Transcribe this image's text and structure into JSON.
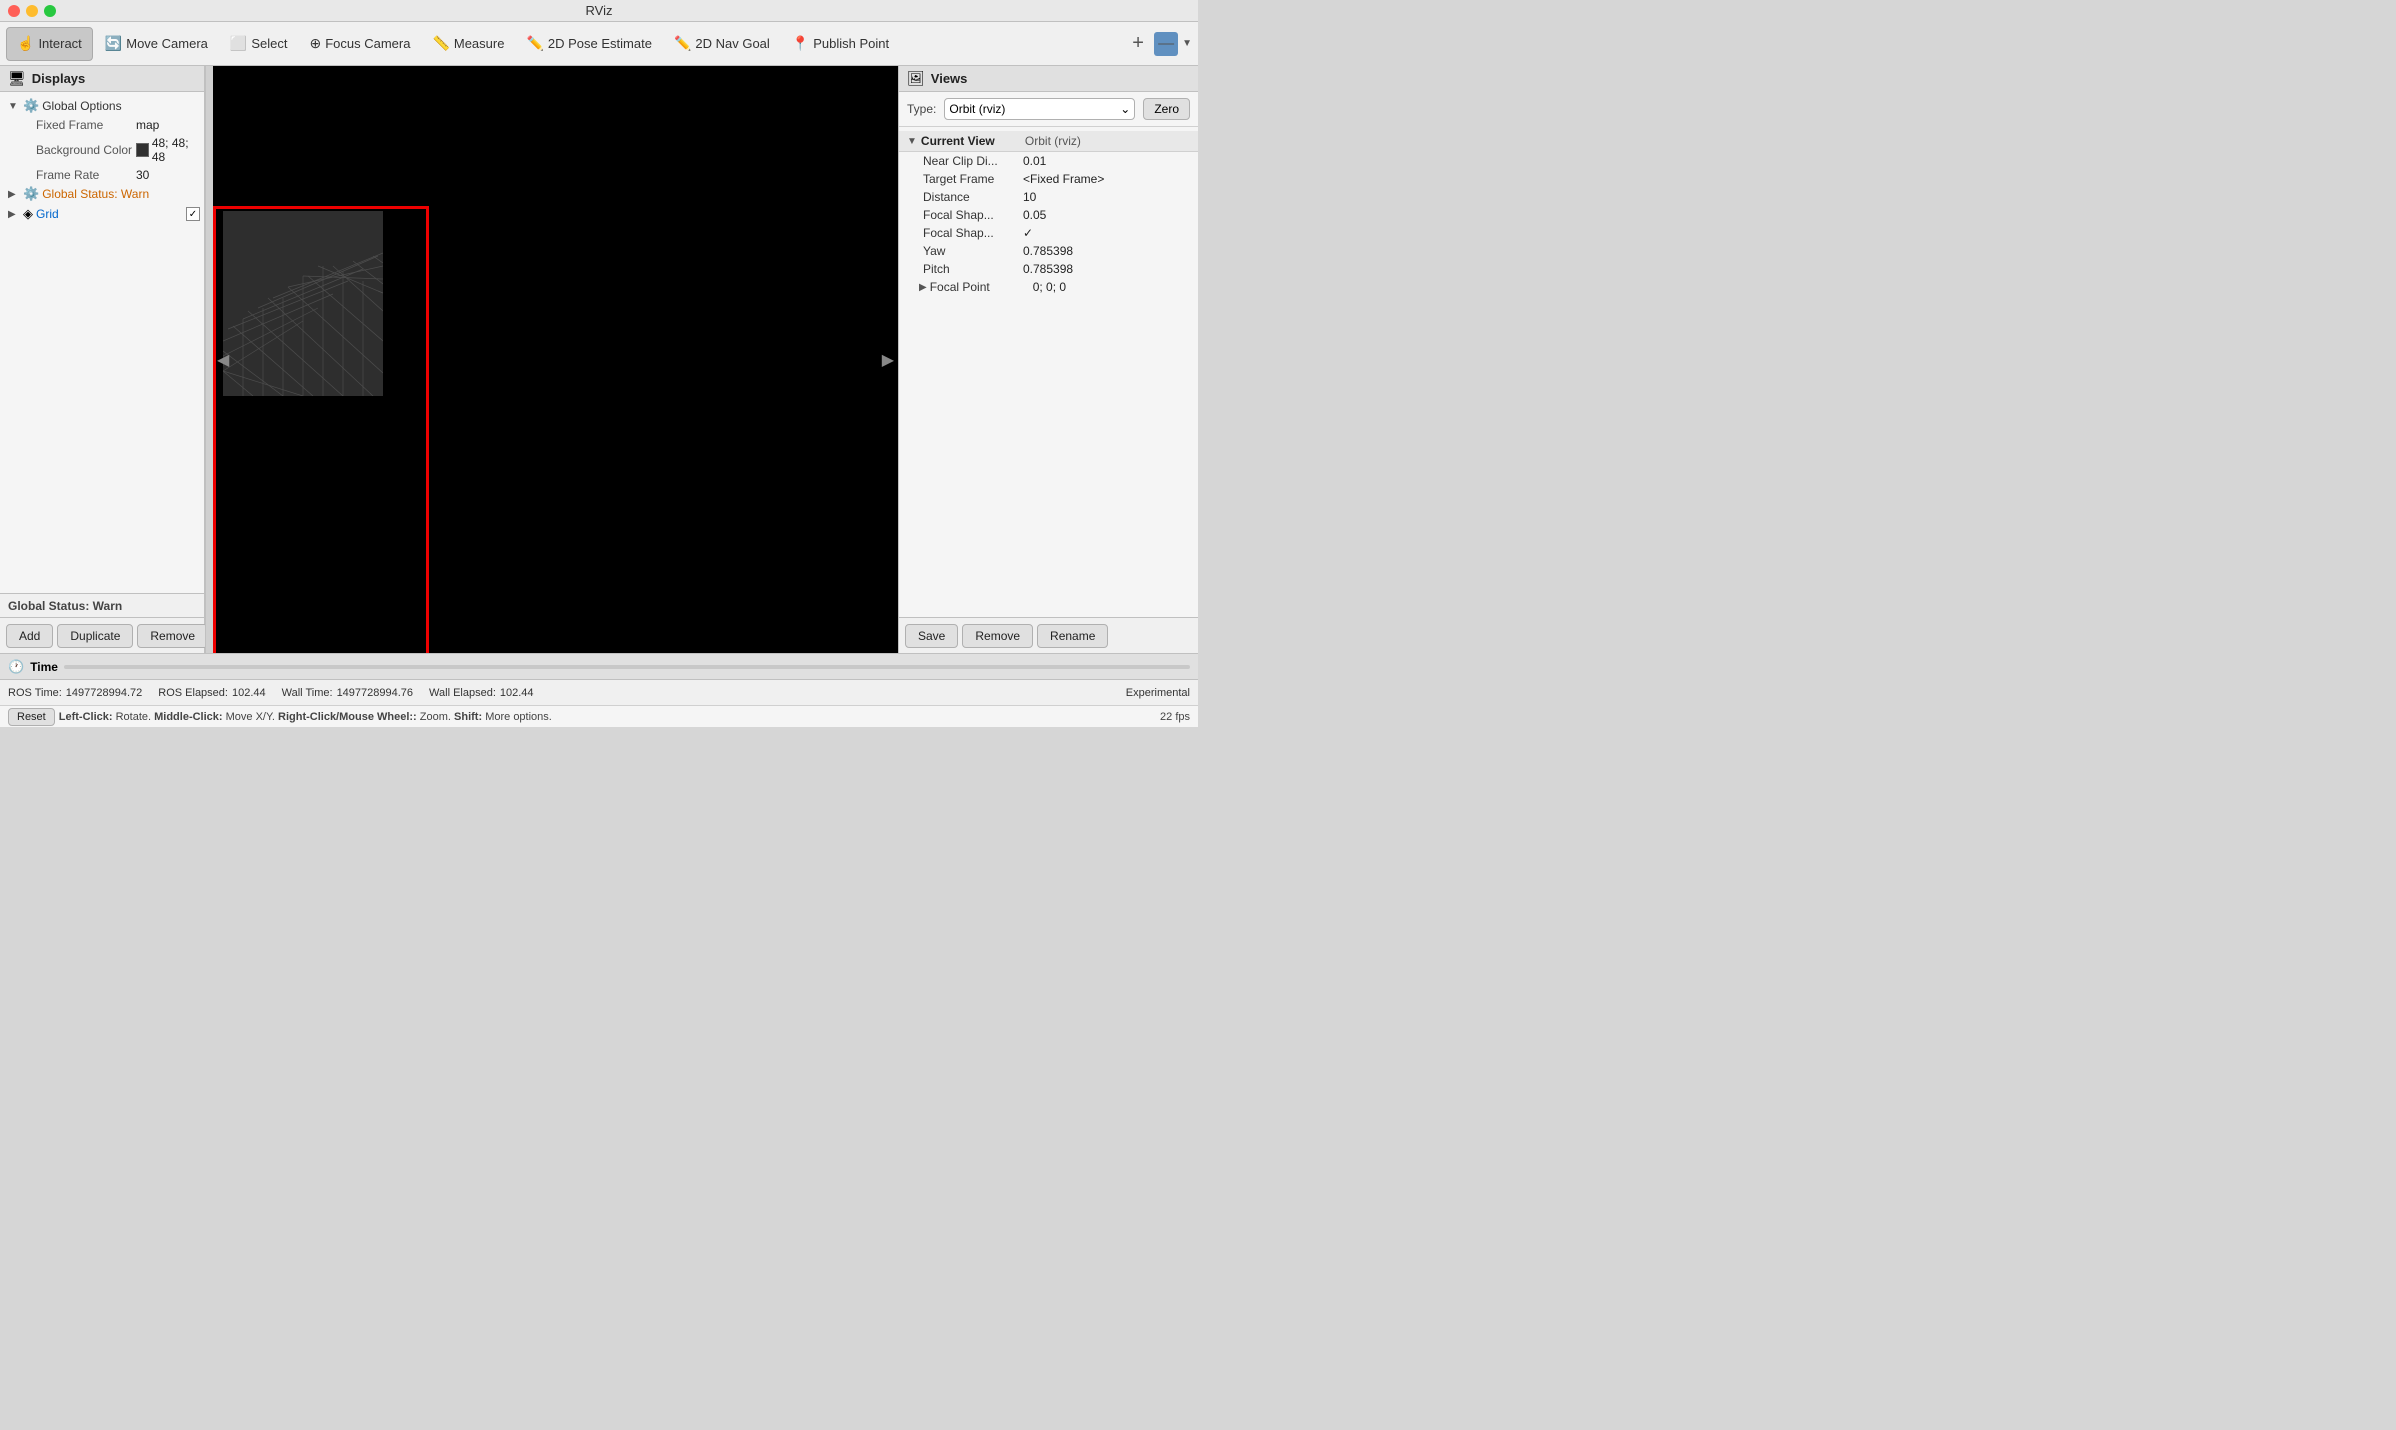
{
  "titlebar": {
    "title": "RViz"
  },
  "toolbar": {
    "interact_label": "Interact",
    "move_camera_label": "Move Camera",
    "select_label": "Select",
    "focus_camera_label": "Focus Camera",
    "measure_label": "Measure",
    "pose_estimate_label": "2D Pose Estimate",
    "nav_goal_label": "2D Nav Goal",
    "publish_point_label": "Publish Point"
  },
  "left_panel": {
    "title": "Displays",
    "global_options": {
      "label": "Global Options",
      "fixed_frame_label": "Fixed Frame",
      "fixed_frame_value": "map",
      "background_color_label": "Background Color",
      "background_color_value": "48; 48; 48",
      "frame_rate_label": "Frame Rate",
      "frame_rate_value": "30"
    },
    "global_status": {
      "label": "Global Status: Warn"
    },
    "grid": {
      "label": "Grid"
    },
    "status_warn": "Global Status: Warn"
  },
  "bottom_buttons": {
    "add": "Add",
    "duplicate": "Duplicate",
    "remove": "Remove",
    "rename": "Rename"
  },
  "right_panel": {
    "title": "Views",
    "type_label": "Type:",
    "type_value": "Orbit (rviz)",
    "zero_btn": "Zero",
    "current_view": {
      "label": "Current View",
      "type": "Orbit (rviz)",
      "near_clip": {
        "name": "Near Clip Di...",
        "value": "0.01"
      },
      "target_frame": {
        "name": "Target Frame",
        "value": "<Fixed Frame>"
      },
      "distance": {
        "name": "Distance",
        "value": "10"
      },
      "focal_shape1": {
        "name": "Focal Shap...",
        "value": "0.05"
      },
      "focal_shape2": {
        "name": "Focal Shap...",
        "value": "✓"
      },
      "yaw": {
        "name": "Yaw",
        "value": "0.785398"
      },
      "pitch": {
        "name": "Pitch",
        "value": "0.785398"
      },
      "focal_point": {
        "name": "Focal Point",
        "value": "0; 0; 0"
      }
    },
    "save_btn": "Save",
    "remove_btn": "Remove",
    "rename_btn": "Rename"
  },
  "time_bar": {
    "label": "Time"
  },
  "bottom_status": {
    "ros_time_label": "ROS Time:",
    "ros_time_value": "1497728994.72",
    "ros_elapsed_label": "ROS Elapsed:",
    "ros_elapsed_value": "102.44",
    "wall_time_label": "Wall Time:",
    "wall_time_value": "1497728994.76",
    "wall_elapsed_label": "Wall Elapsed:",
    "wall_elapsed_value": "102.44",
    "experimental": "Experimental"
  },
  "hint_bar": {
    "reset": "Reset",
    "hint": "Left-Click: Rotate. Middle-Click: Move X/Y. Right-Click/Mouse Wheel:: Zoom. Shift: More options.",
    "fps": "22 fps"
  }
}
